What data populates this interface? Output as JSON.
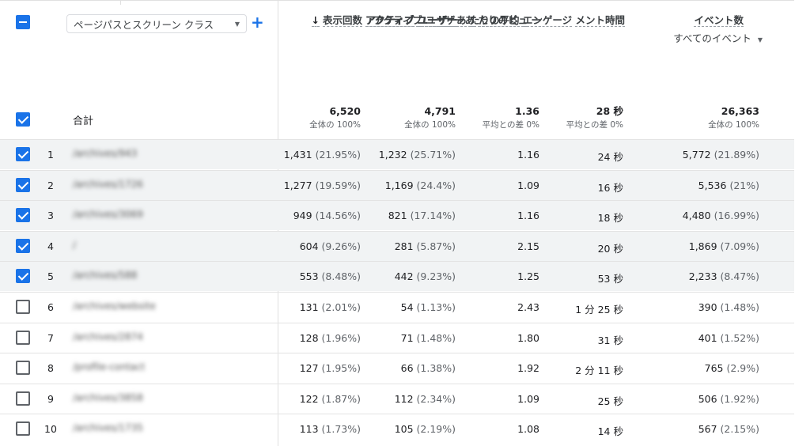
{
  "header": {
    "dimension_select": "ページパスとスクリーン クラス",
    "add_dimension": "+",
    "sort_arrow": "↓",
    "columns": {
      "views": [
        "表示回数"
      ],
      "active_users": [
        "アクティブ",
        "ユーザー"
      ],
      "views_per_user": [
        "アクティブ",
        "ユーザーあ",
        "たりのビュ",
        "ー"
      ],
      "avg_engagement": [
        "アクティブ",
        "ユーザーあ",
        "たりの平均",
        "エンゲージ",
        "メント時間"
      ],
      "event_count": [
        "イベント数"
      ]
    },
    "event_select": "すべてのイベント"
  },
  "totals": {
    "label": "合計",
    "views": "6,520",
    "views_sub": "全体の 100%",
    "active_users": "4,791",
    "active_users_sub": "全体の 100%",
    "views_per_user": "1.36",
    "views_per_user_sub": "平均との差 0%",
    "avg_engagement": "28 秒",
    "avg_engagement_sub": "平均との差 0%",
    "event_count": "26,363",
    "event_count_sub": "全体の 100%"
  },
  "rows": [
    {
      "num": "1",
      "page": "/archives/943",
      "checked": true,
      "views": "1,431",
      "views_pct": "(21.95%)",
      "users": "1,232",
      "users_pct": "(25.71%)",
      "vpu": "1.16",
      "eng": "24 秒",
      "events": "5,772",
      "events_pct": "(21.89%)"
    },
    {
      "num": "2",
      "page": "/archives/1726",
      "checked": true,
      "views": "1,277",
      "views_pct": "(19.59%)",
      "users": "1,169",
      "users_pct": "(24.4%)",
      "vpu": "1.09",
      "eng": "16 秒",
      "events": "5,536",
      "events_pct": "(21%)"
    },
    {
      "num": "3",
      "page": "/archives/3069",
      "checked": true,
      "views": "949",
      "views_pct": "(14.56%)",
      "users": "821",
      "users_pct": "(17.14%)",
      "vpu": "1.16",
      "eng": "18 秒",
      "events": "4,480",
      "events_pct": "(16.99%)"
    },
    {
      "num": "4",
      "page": "/",
      "checked": true,
      "views": "604",
      "views_pct": "(9.26%)",
      "users": "281",
      "users_pct": "(5.87%)",
      "vpu": "2.15",
      "eng": "20 秒",
      "events": "1,869",
      "events_pct": "(7.09%)"
    },
    {
      "num": "5",
      "page": "/archives/588",
      "checked": true,
      "views": "553",
      "views_pct": "(8.48%)",
      "users": "442",
      "users_pct": "(9.23%)",
      "vpu": "1.25",
      "eng": "53 秒",
      "events": "2,233",
      "events_pct": "(8.47%)"
    },
    {
      "num": "6",
      "page": "/archives/website",
      "checked": false,
      "views": "131",
      "views_pct": "(2.01%)",
      "users": "54",
      "users_pct": "(1.13%)",
      "vpu": "2.43",
      "eng": "1 分 25 秒",
      "events": "390",
      "events_pct": "(1.48%)"
    },
    {
      "num": "7",
      "page": "/archives/2874",
      "checked": false,
      "views": "128",
      "views_pct": "(1.96%)",
      "users": "71",
      "users_pct": "(1.48%)",
      "vpu": "1.80",
      "eng": "31 秒",
      "events": "401",
      "events_pct": "(1.52%)"
    },
    {
      "num": "8",
      "page": "/profile-contact",
      "checked": false,
      "views": "127",
      "views_pct": "(1.95%)",
      "users": "66",
      "users_pct": "(1.38%)",
      "vpu": "1.92",
      "eng": "2 分 11 秒",
      "events": "765",
      "events_pct": "(2.9%)"
    },
    {
      "num": "9",
      "page": "/archives/3858",
      "checked": false,
      "views": "122",
      "views_pct": "(1.87%)",
      "users": "112",
      "users_pct": "(2.34%)",
      "vpu": "1.09",
      "eng": "25 秒",
      "events": "506",
      "events_pct": "(1.92%)"
    },
    {
      "num": "10",
      "page": "/archives/1735",
      "checked": false,
      "views": "113",
      "views_pct": "(1.73%)",
      "users": "105",
      "users_pct": "(2.19%)",
      "vpu": "1.08",
      "eng": "14 秒",
      "events": "567",
      "events_pct": "(2.15%)"
    }
  ],
  "colors": {
    "accent": "#1a73e8",
    "selected_row": "#f1f3f4",
    "border": "#e0e0e0"
  },
  "icons": {
    "select_all": "indeterminate-checkbox-icon",
    "checked": "checkbox-checked-icon",
    "unchecked": "checkbox-unchecked-icon",
    "dropdown": "caret-down-icon",
    "sort": "arrow-down-icon"
  }
}
